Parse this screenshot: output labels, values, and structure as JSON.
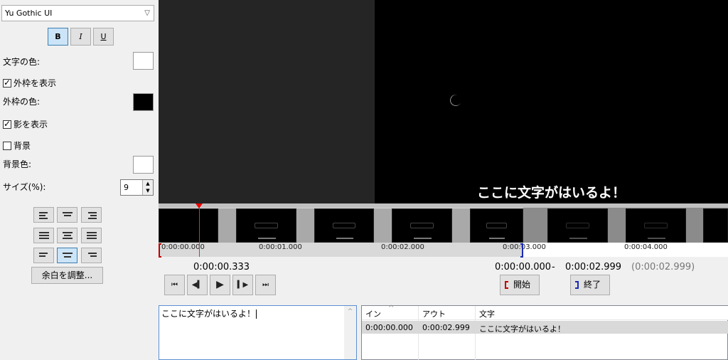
{
  "font": {
    "name": "Yu Gothic UI"
  },
  "style_buttons": {
    "bold": "B",
    "italic": "I",
    "underline": "U"
  },
  "labels": {
    "text_color": "文字の色:",
    "show_outline": "外枠を表示",
    "outline_color": "外枠の色:",
    "show_shadow": "影を表示",
    "background": "背景",
    "background_color": "背景色:",
    "size": "サイズ(%):"
  },
  "checkboxes": {
    "show_outline": true,
    "show_shadow": true,
    "background": false
  },
  "colors": {
    "text_color": "#ffffff",
    "outline_color": "#000000",
    "background_color": "#ffffff"
  },
  "size_value": "9",
  "margin_button": "余白を調整...",
  "video": {
    "subtitle": "ここに文字がはいるよ！"
  },
  "timeline": {
    "ticks": [
      "0:00:00.000",
      "0:00:01.000",
      "0:00:02.000",
      "0:00:03.000",
      "0:00:04.000"
    ]
  },
  "transport": {
    "current_time": "0:00:00.333",
    "buttons": [
      "prev-frame-icon",
      "step-back-icon",
      "play-icon",
      "step-forward-icon",
      "next-frame-icon"
    ]
  },
  "range": {
    "in": "0:00:00.000",
    "dash": "-",
    "out": "0:00:02.999",
    "duration": "(0:00:02.999)"
  },
  "mark_buttons": {
    "start": "開始",
    "end": "終了"
  },
  "editor": {
    "text": "ここに文字がはいるよ！"
  },
  "list": {
    "headers": {
      "in": "イン",
      "out": "アウト",
      "text": "文字"
    },
    "rows": [
      {
        "in": "0:00:00.000",
        "out": "0:00:02.999",
        "text": "ここに文字がはいるよ！"
      }
    ]
  }
}
